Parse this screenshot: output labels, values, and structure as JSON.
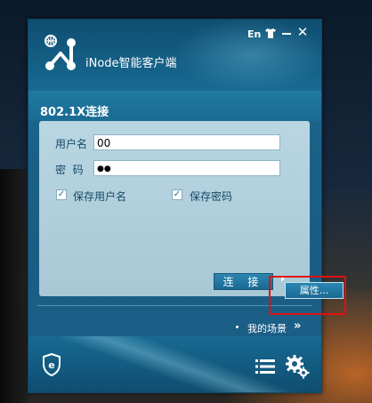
{
  "app": {
    "title": "iNode智能客户端",
    "language_label": "En",
    "close_glyph": "✕"
  },
  "connection": {
    "title": "802.1X连接",
    "username_label": "用户名",
    "username_value": "00",
    "password_label": "密  码",
    "password_value": "●●",
    "save_username_label": "保存用户名",
    "save_username_checked": true,
    "save_password_label": "保存密码",
    "save_password_checked": true,
    "connect_label": "连 接",
    "dropdown_item": "属性..."
  },
  "footer": {
    "scene_label": "我的场景",
    "scene_arrow": "»"
  },
  "colors": {
    "accent": "#1d6e93",
    "panel": "#b9d6e2",
    "highlight": "#e01010"
  },
  "icons": [
    "app-logo-icon",
    "shirt-icon",
    "minimize-icon",
    "close-icon",
    "shield-e-icon",
    "list-icon",
    "gear-icon"
  ]
}
